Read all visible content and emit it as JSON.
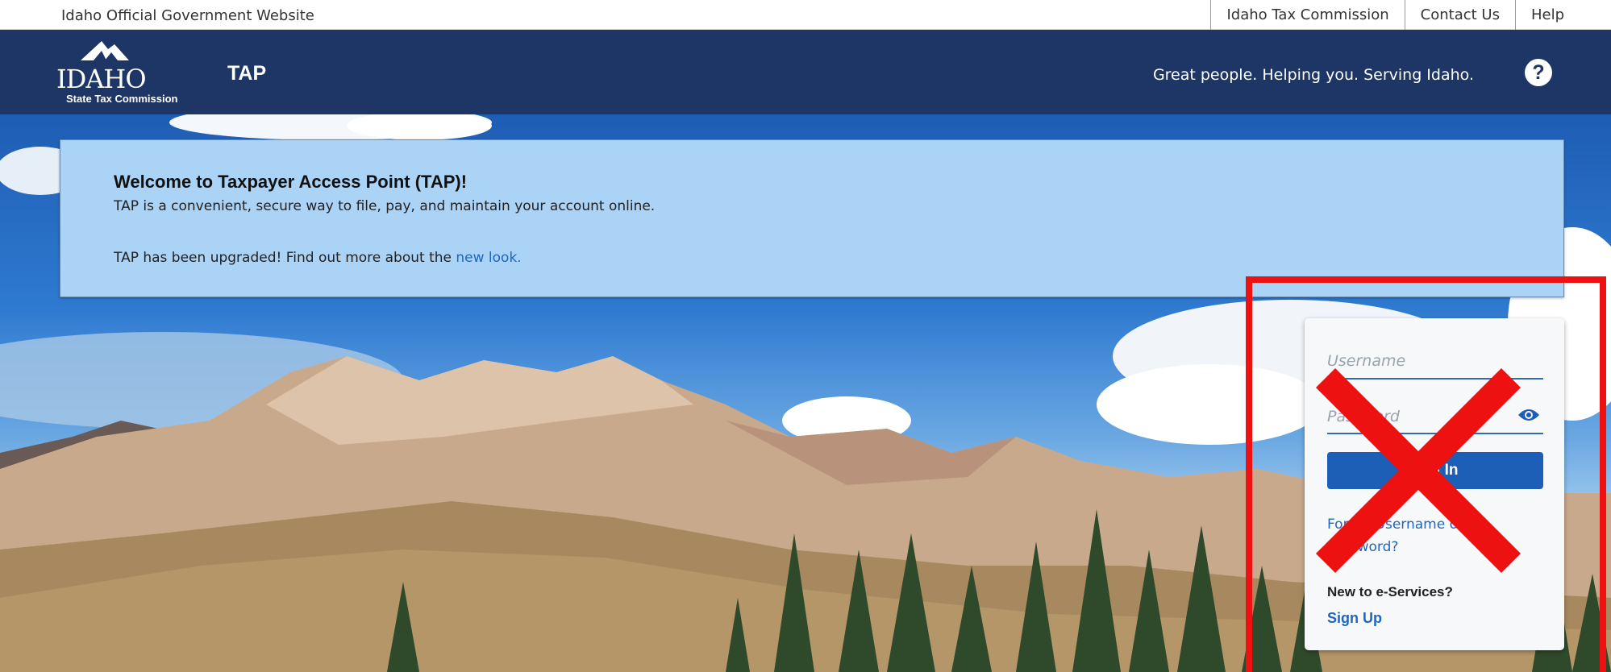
{
  "utility_bar": {
    "official_text": "Idaho Official Government Website",
    "links": [
      "Idaho Tax Commission",
      "Contact Us",
      "Help"
    ]
  },
  "header": {
    "logo_word": "IDAHO",
    "logo_sub": "State Tax Commission",
    "app_name": "TAP",
    "tagline": "Great people. Helping you. Serving Idaho.",
    "help_icon": "?",
    "colors": {
      "header_bg": "#1d3665",
      "accent": "#1d5fb6"
    }
  },
  "welcome": {
    "title": "Welcome to Taxpayer Access Point (TAP)!",
    "description": "TAP is a convenient, secure way to file, pay, and maintain your account online.",
    "upgrade_prefix": "TAP has been upgraded! Find out more about the ",
    "upgrade_link": "new look."
  },
  "login": {
    "username_placeholder": "Username",
    "password_placeholder": "Password",
    "password_toggle_icon": "eye-icon",
    "login_button": "Log In",
    "forgot_link": "Forgot Username or Password?",
    "new_label": "New to e-Services?",
    "signup_link": "Sign Up"
  },
  "annotation": {
    "marker": "red-x-icon",
    "color": "#ee1111"
  }
}
